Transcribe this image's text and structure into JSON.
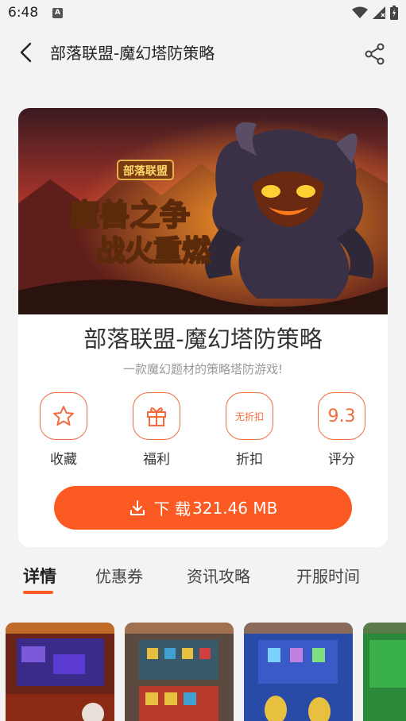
{
  "status": {
    "time": "6:48"
  },
  "nav": {
    "title": "部落联盟-魔幻塔防策略"
  },
  "app": {
    "name": "部落联盟-魔幻塔防策略",
    "subtitle": "一款魔幻题材的策略塔防游戏!",
    "banner_logo": "部落联盟",
    "banner_slogan_1": "魔兽之争",
    "banner_slogan_2": "战火重燃"
  },
  "actions": [
    {
      "icon": "star-icon",
      "label": "收藏"
    },
    {
      "icon": "gift-icon",
      "label": "福利"
    },
    {
      "icon_text": "无折扣",
      "label": "折扣"
    },
    {
      "value": "9.3",
      "label": "评分"
    }
  ],
  "download": {
    "label": "下 载",
    "size": "321.46 MB"
  },
  "tabs": [
    "详情",
    "优惠券",
    "资讯攻略",
    "开服时间"
  ],
  "active_tab": "详情",
  "colors": {
    "accent": "#fb5a22",
    "outline": "#f26b3a",
    "background": "#f3f3f3"
  }
}
